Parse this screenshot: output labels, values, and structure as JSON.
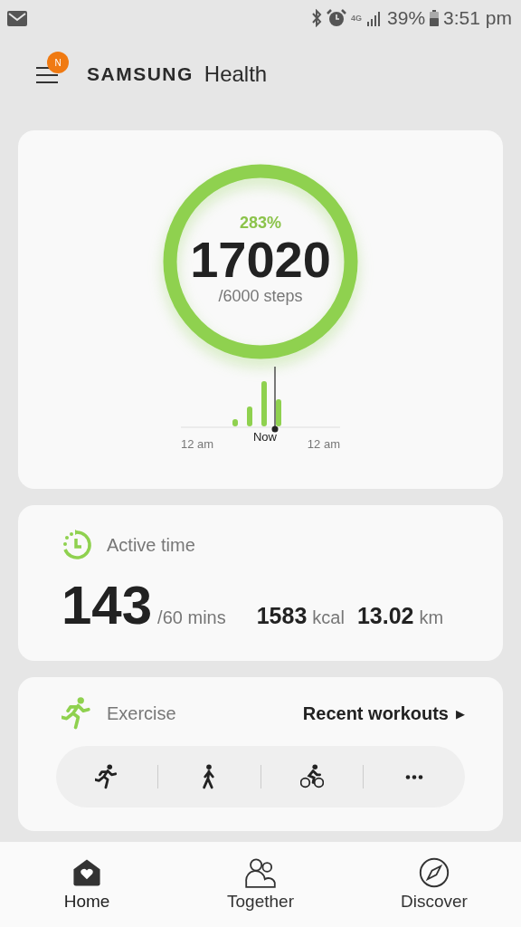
{
  "status_bar": {
    "battery": "39%",
    "time": "3:51 pm",
    "network": "4G"
  },
  "header": {
    "badge": "N",
    "brand": "SAMSUNG",
    "product": "Health"
  },
  "steps_card": {
    "percent": "283%",
    "count": "17020",
    "goal": "/6000 steps",
    "axis_labels": [
      "12 am",
      "12 am"
    ],
    "now_label": "Now"
  },
  "active_card": {
    "title": "Active time",
    "minutes": "143",
    "goal": "/60 mins",
    "calories": "1583",
    "calories_unit": "kcal",
    "distance": "13.02",
    "distance_unit": "km"
  },
  "exercise_card": {
    "title": "Exercise",
    "link": "Recent workouts",
    "link_arrow": "▶",
    "shortcuts": [
      {
        "kind": "run"
      },
      {
        "kind": "walk"
      },
      {
        "kind": "cycle"
      },
      {
        "kind": "more"
      }
    ]
  },
  "bottom_nav": [
    {
      "label": "Home",
      "kind": "home",
      "selected": true
    },
    {
      "label": "Together",
      "kind": "together",
      "selected": false
    },
    {
      "label": "Discover",
      "kind": "discover",
      "selected": false
    }
  ]
}
